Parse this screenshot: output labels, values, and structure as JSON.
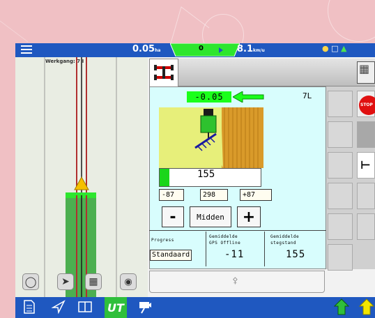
{
  "background": {
    "corner_text": ""
  },
  "topbar": {
    "menu_icon": "hamburger-menu-icon",
    "area_value": "0.05",
    "area_unit": "ha",
    "guidance_offset": "0",
    "speed_value": "8.1",
    "speed_unit": "km/u",
    "status_icons": [
      "gps-satellite-icon",
      "display-icon",
      "signal-icon"
    ]
  },
  "map": {
    "field_label": "Werkgang: 7 I",
    "buttons": [
      "recenter-icon",
      "navigation-arrow-icon",
      "map-view-icon",
      "location-pin-icon"
    ]
  },
  "ut": {
    "tab_icon": "implement-icon",
    "offset_value": "-0.05",
    "row_label": "7L",
    "bar_value": "155",
    "left_limit": "-87",
    "center_value": "298",
    "right_limit": "+87",
    "minus_label": "-",
    "mode_label": "Midden",
    "plus_label": "+",
    "progress_label": "Progress",
    "progress_value": "Standaard",
    "avg_label_line1": "Gemiddelde",
    "avg_label_line2": "GPS Offline",
    "avg_value": "-11",
    "avg2_label_line1": "Gemiddelde",
    "avg2_label_line2": "stegstand",
    "avg2_value": "155",
    "stop_label": "STOP"
  },
  "bottombar": {
    "buttons": [
      "document-icon",
      "guidance-icon",
      "split-view-icon",
      "ut-label",
      "camera-icon"
    ],
    "ut_label": "UT"
  },
  "colors": {
    "bar_blue": "#1f58c0",
    "ut_green": "#2fbf3b",
    "highlight_green": "#1aff1a",
    "ut_background": "#d8fdfd"
  }
}
